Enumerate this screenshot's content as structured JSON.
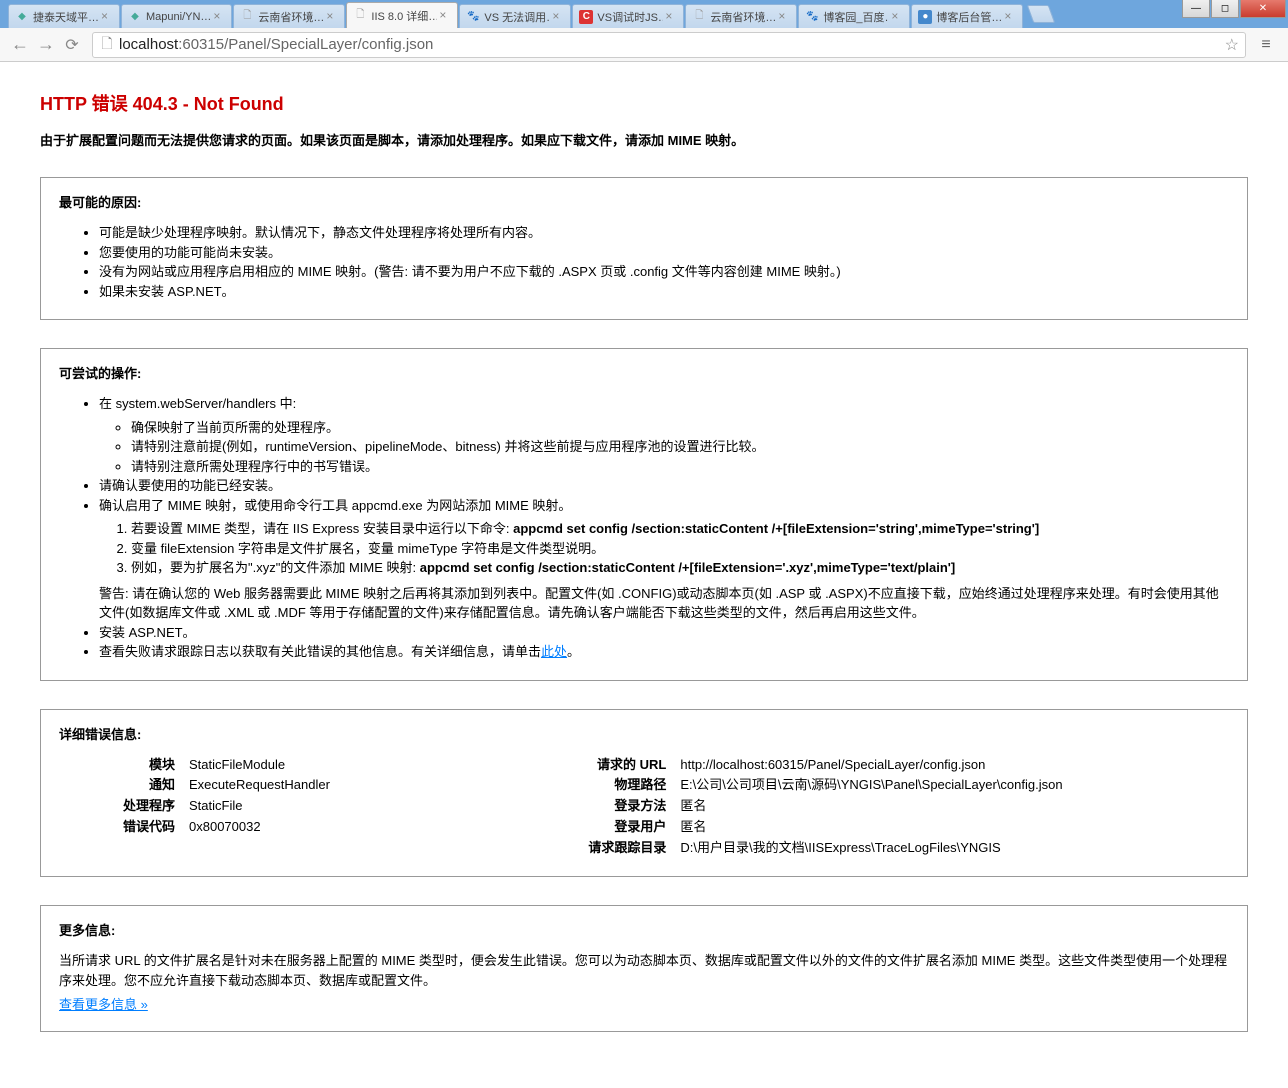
{
  "tabs": [
    {
      "title": "捷泰天域平…",
      "icon_class": "green"
    },
    {
      "title": "Mapuni/YN…",
      "icon_class": "green"
    },
    {
      "title": "云南省环境…",
      "icon_class": "doc"
    },
    {
      "title": "IIS 8.0 详细…",
      "icon_class": "doc",
      "active": true
    },
    {
      "title": "VS 无法调用…",
      "icon_class": "paw"
    },
    {
      "title": "VS调试时JS…",
      "icon_class": "red",
      "icon_text": "C"
    },
    {
      "title": "云南省环境…",
      "icon_class": "doc"
    },
    {
      "title": "博客园_百度…",
      "icon_class": "paw"
    },
    {
      "title": "博客后台管…",
      "icon_class": "blue"
    }
  ],
  "url": {
    "host": "localhost",
    "port_path": ":60315/Panel/SpecialLayer/config.json"
  },
  "error": {
    "title": "HTTP 错误 404.3 - Not Found",
    "desc": "由于扩展配置问题而无法提供您请求的页面。如果该页面是脚本，请添加处理程序。如果应下载文件，请添加 MIME 映射。"
  },
  "causes": {
    "heading": "最可能的原因:",
    "items": [
      "可能是缺少处理程序映射。默认情况下，静态文件处理程序将处理所有内容。",
      "您要使用的功能可能尚未安装。",
      "没有为网站或应用程序启用相应的 MIME 映射。(警告: 请不要为用户不应下载的 .ASPX 页或 .config 文件等内容创建 MIME 映射。)",
      "如果未安装 ASP.NET。"
    ]
  },
  "things": {
    "heading": "可尝试的操作:",
    "item1": "在 system.webServer/handlers 中:",
    "sub1": "确保映射了当前页所需的处理程序。",
    "sub2": "请特别注意前提(例如，runtimeVersion、pipelineMode、bitness) 并将这些前提与应用程序池的设置进行比较。",
    "sub3": "请特别注意所需处理程序行中的书写错误。",
    "item2": "请确认要使用的功能已经安装。",
    "item3": "确认启用了 MIME 映射，或使用命令行工具 appcmd.exe 为网站添加 MIME 映射。",
    "num1_pre": "若要设置 MIME 类型，请在 IIS Express 安装目录中运行以下命令: ",
    "num1_cmd": "appcmd set config /section:staticContent /+[fileExtension='string',mimeType='string']",
    "num2": "变量 fileExtension 字符串是文件扩展名，变量 mimeType 字符串是文件类型说明。",
    "num3_pre": "例如，要为扩展名为\".xyz\"的文件添加 MIME 映射: ",
    "num3_cmd": "appcmd set config /section:staticContent /+[fileExtension='.xyz',mimeType='text/plain']",
    "warn": "警告: 请在确认您的 Web 服务器需要此 MIME 映射之后再将其添加到列表中。配置文件(如 .CONFIG)或动态脚本页(如 .ASP 或 .ASPX)不应直接下载，应始终通过处理程序来处理。有时会使用其他文件(如数据库文件或 .XML 或 .MDF 等用于存储配置的文件)来存储配置信息。请先确认客户端能否下载这些类型的文件，然后再启用这些文件。",
    "item4": "安装 ASP.NET。",
    "item5_pre": "查看失败请求跟踪日志以获取有关此错误的其他信息。有关详细信息，请单击",
    "item5_link": "此处",
    "item5_post": "。"
  },
  "details": {
    "heading": "详细错误信息:",
    "left": [
      {
        "label": "模块",
        "value": "StaticFileModule"
      },
      {
        "label": "通知",
        "value": "ExecuteRequestHandler"
      },
      {
        "label": "处理程序",
        "value": "StaticFile"
      },
      {
        "label": "错误代码",
        "value": "0x80070032"
      }
    ],
    "right": [
      {
        "label": "请求的 URL",
        "value": "http://localhost:60315/Panel/SpecialLayer/config.json"
      },
      {
        "label": "物理路径",
        "value": "E:\\公司\\公司项目\\云南\\源码\\YNGIS\\Panel\\SpecialLayer\\config.json"
      },
      {
        "label": "登录方法",
        "value": "匿名"
      },
      {
        "label": "登录用户",
        "value": "匿名"
      },
      {
        "label": "请求跟踪目录",
        "value": "D:\\用户目录\\我的文档\\IISExpress\\TraceLogFiles\\YNGIS"
      }
    ]
  },
  "more": {
    "heading": "更多信息:",
    "text": "当所请求 URL 的文件扩展名是针对未在服务器上配置的 MIME 类型时，便会发生此错误。您可以为动态脚本页、数据库或配置文件以外的文件的文件扩展名添加 MIME 类型。这些文件类型使用一个处理程序来处理。您不应允许直接下载动态脚本页、数据库或配置文件。",
    "link": "查看更多信息 »"
  }
}
